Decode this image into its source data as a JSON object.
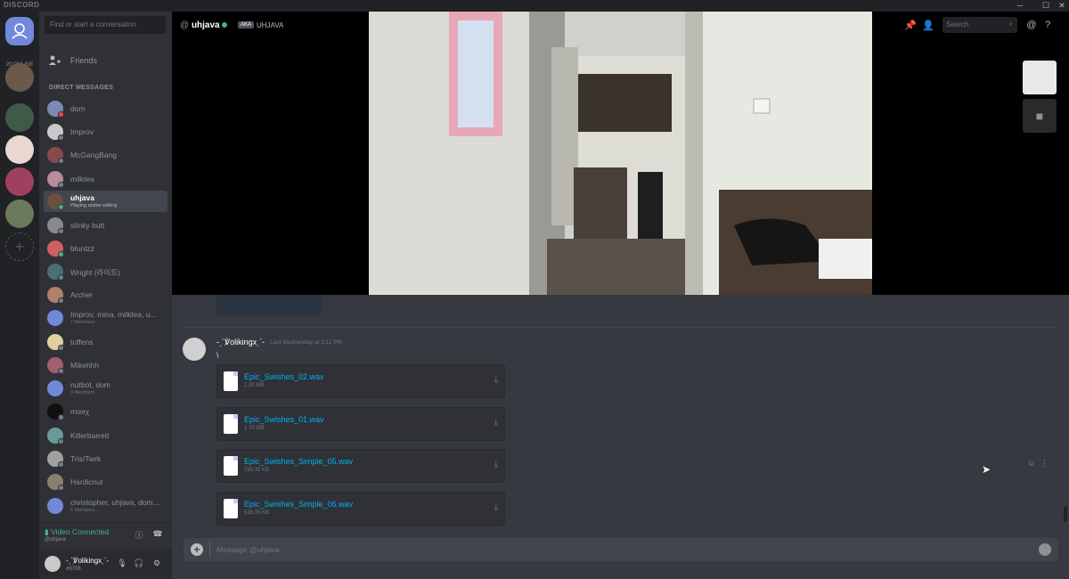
{
  "app": {
    "brand": "DISCORD"
  },
  "guilds": {
    "online_label": "20 ONLINE"
  },
  "sidebar": {
    "search_placeholder": "Find or start a conversation",
    "friends_label": "Friends",
    "dm_header": "DIRECT MESSAGES",
    "dms": [
      {
        "name": "dom",
        "status": "#f04747",
        "avatar": "#7a8ab0"
      },
      {
        "name": "Improv",
        "status": "#747f8d",
        "avatar": "#c9c9c9"
      },
      {
        "name": "McGangBang",
        "status": "#747f8d",
        "avatar": "#8a4a4a"
      },
      {
        "name": "milktea",
        "status": "#747f8d",
        "avatar": "#b88c9a"
      },
      {
        "name": "uhjava",
        "sub": "Playing anime editing",
        "status": "#43b581",
        "avatar": "#6a5040"
      },
      {
        "name": "stinky butt",
        "status": "#747f8d",
        "avatar": "#8a8a8a"
      },
      {
        "name": "bluntzz",
        "status": "#43b581",
        "avatar": "#d06060"
      },
      {
        "name": "Wright (라이트)",
        "status": "#747f8d",
        "avatar": "#4a7070"
      },
      {
        "name": "Archer",
        "status": "#747f8d",
        "avatar": "#b0806a"
      },
      {
        "name": "Improv, mina, milktea, u...",
        "sub": "7 Members",
        "status": "",
        "avatar": "#7289da"
      },
      {
        "name": "tuffens",
        "status": "#747f8d",
        "avatar": "#e0d0a0"
      },
      {
        "name": "Mikehhh",
        "status": "#747f8d",
        "avatar": "#a06070"
      },
      {
        "name": "nutbot, dom",
        "sub": "3 Members",
        "status": "",
        "avatar": "#7289da"
      },
      {
        "name": "mαяχ",
        "status": "#747f8d",
        "avatar": "#101010"
      },
      {
        "name": "Killerbarrett",
        "status": "#747f8d",
        "avatar": "#6a9a9a"
      },
      {
        "name": "Tris/Twrk",
        "status": "#747f8d",
        "avatar": "#a0a0a0"
      },
      {
        "name": "Hardicnut",
        "status": "#747f8d",
        "avatar": "#8a8070"
      },
      {
        "name": "christopher, uhjava, dom...",
        "sub": "5 Members",
        "status": "",
        "avatar": "#7289da"
      }
    ],
    "voice_status": "Video Connected",
    "voice_user": "@uhjava",
    "me_name": "-ˏˋ℣olikingxˎˊ-",
    "me_tag": "#9708"
  },
  "header": {
    "at": "@",
    "username": "uhjava",
    "aka_badge": "AKA",
    "aka_name": "UHJAVA",
    "search_placeholder": "Search"
  },
  "message": {
    "author": "-ˏˋ℣olikingxˎˊ-",
    "time": "Last Wednesday at 3:11 PM",
    "text": "\\",
    "attachments": [
      {
        "filename": "Epic_Swishes_02.wav",
        "size": "1.30 MB"
      },
      {
        "filename": "Epic_Swishes_01.wav",
        "size": "1.70 MB"
      },
      {
        "filename": "Epic_Swishes_Simple_05.wav",
        "size": "799.35 KB"
      },
      {
        "filename": "Epic_Swishes_Simple_06.wav",
        "size": "536.35 KB"
      }
    ]
  },
  "composer": {
    "placeholder": "Message @uhjava"
  }
}
